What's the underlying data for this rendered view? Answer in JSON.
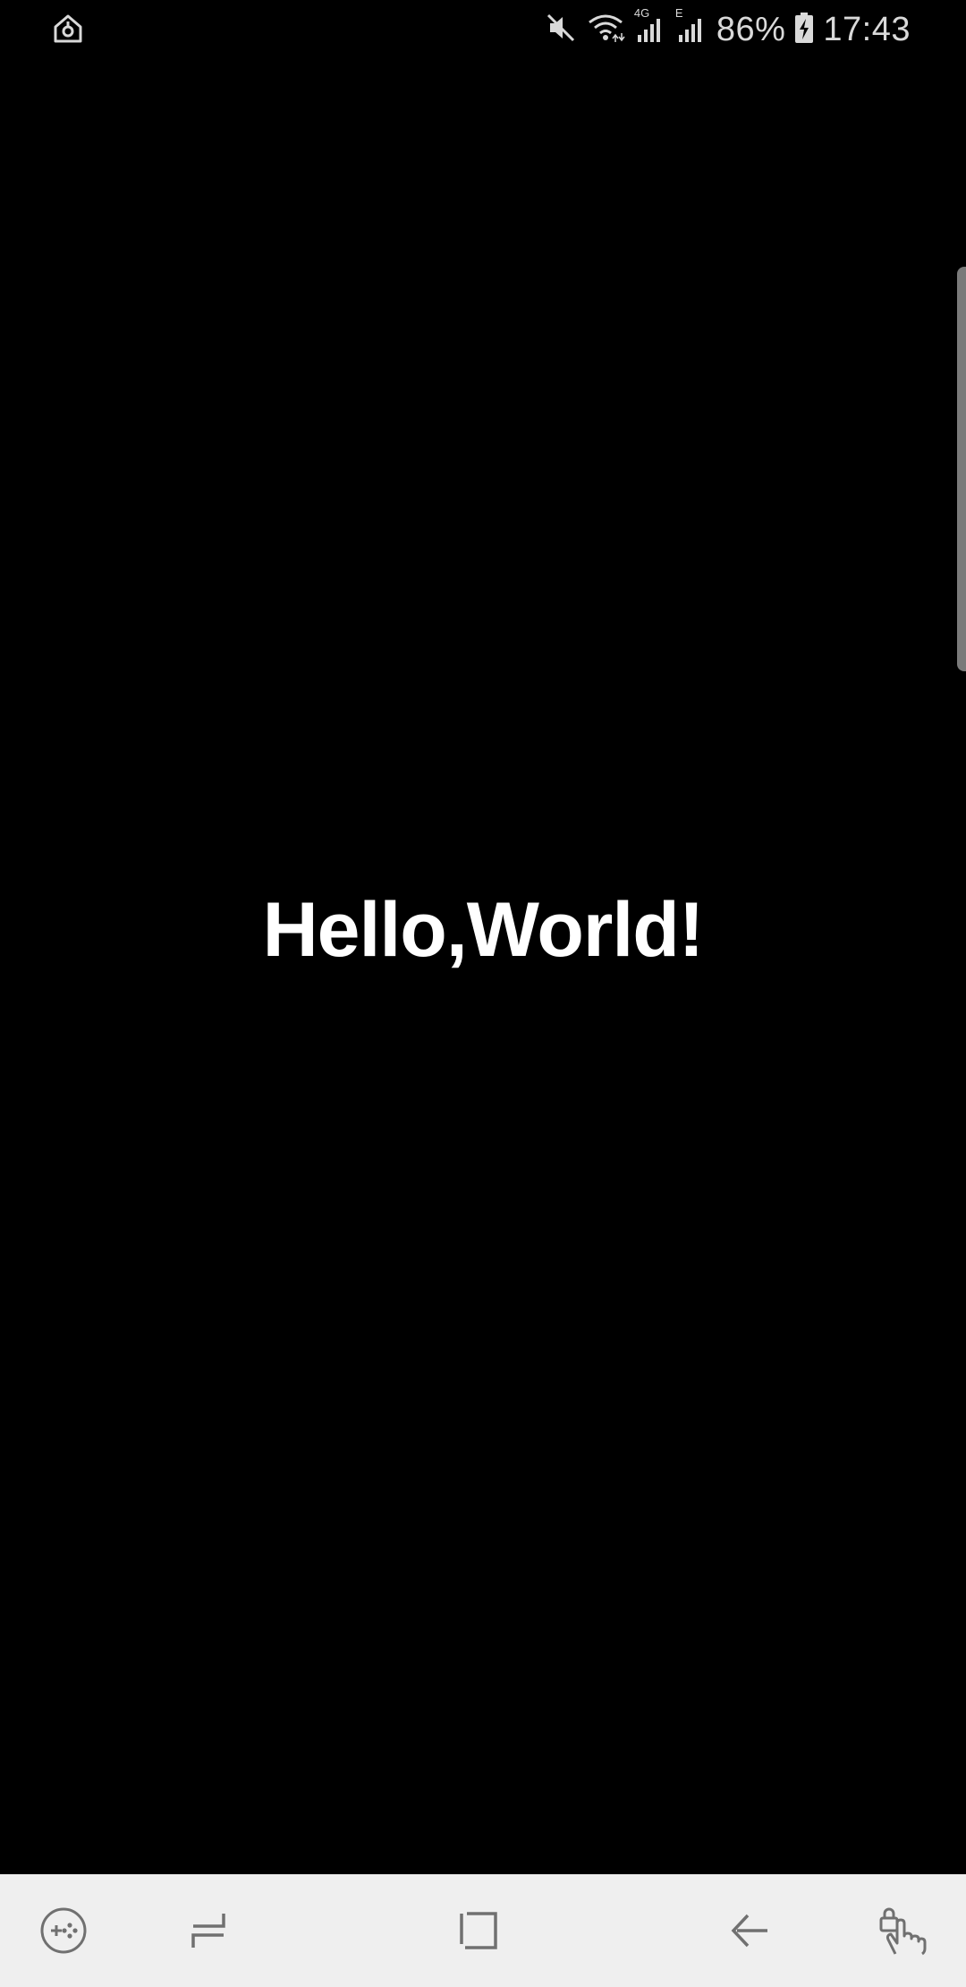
{
  "status_bar": {
    "battery_percent": "86%",
    "time": "17:43",
    "network_label": "4G",
    "secondary_network_label": "E",
    "icons": {
      "left": "home-screen-icon",
      "mute": "mute-icon",
      "wifi": "wifi-icon",
      "signal_1": "signal-4g-icon",
      "signal_2": "signal-e-icon",
      "battery": "battery-charging-icon"
    }
  },
  "main": {
    "greeting": "Hello,World!"
  },
  "nav_bar": {
    "buttons": [
      {
        "name": "game-tools-button",
        "icon": "gamepad-icon"
      },
      {
        "name": "recents-button",
        "icon": "recents-icon"
      },
      {
        "name": "home-button",
        "icon": "home-square-icon"
      },
      {
        "name": "back-button",
        "icon": "back-arrow-icon"
      },
      {
        "name": "touch-lock-button",
        "icon": "touch-lock-icon"
      }
    ]
  },
  "colors": {
    "background": "#000000",
    "text": "#ffffff",
    "nav_bar": "#efefef",
    "nav_icon": "#707070",
    "status_text": "#d9d9d9"
  }
}
